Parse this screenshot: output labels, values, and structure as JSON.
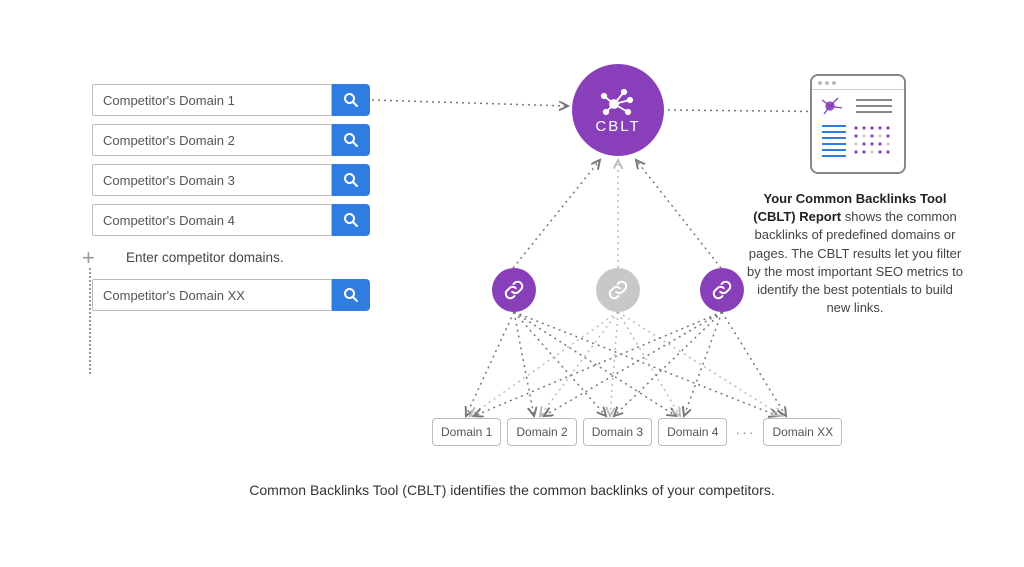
{
  "inputs": {
    "placeholder": "Competitor's Domain",
    "items": [
      "Competitor's Domain 1",
      "Competitor's Domain 2",
      "Competitor's Domain 3",
      "Competitor's Domain 4"
    ],
    "hint": "Enter competitor domains.",
    "extra": "Competitor's Domain XX"
  },
  "hub": {
    "label": "CBLT"
  },
  "domains": [
    "Domain 1",
    "Domain 2",
    "Domain 3",
    "Domain 4",
    "Domain XX"
  ],
  "report": {
    "title": "Your Common Backlinks Tool (CBLT) Report",
    "body": "shows the common backlinks of predefined domains or pages. The CBLT results let you filter by the most important SEO metrics to identify the best potentials to build new links."
  },
  "caption": "Common Backlinks Tool (CBLT) identifies the common backlinks of your competitors."
}
